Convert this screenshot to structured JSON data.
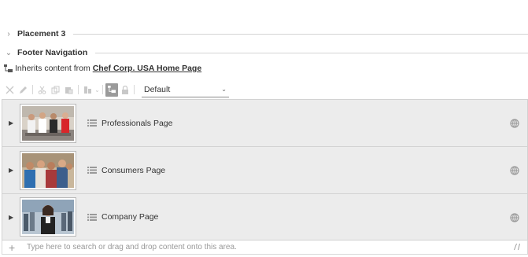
{
  "sections": {
    "placement3": {
      "title": "Placement 3",
      "expanded": false
    },
    "footer_navigation": {
      "title": "Footer Navigation",
      "expanded": true
    }
  },
  "inherit": {
    "prefix": "Inherits content from",
    "link": "Chef Corp. USA Home Page"
  },
  "toolbar": {
    "icons": [
      "close-icon",
      "edit-icon",
      "cut-icon",
      "copy-icon",
      "paste-icon",
      "paste-special-icon",
      "inherit-icon",
      "lock-icon"
    ],
    "select_value": "Default"
  },
  "items": [
    {
      "label": "Professionals Page",
      "thumb": "chefs-kitchen-image"
    },
    {
      "label": "Consumers Page",
      "thumb": "friends-group-image"
    },
    {
      "label": "Company Page",
      "thumb": "business-woman-crowd-image"
    }
  ],
  "dropzone": {
    "placeholder": "Type here to search or drag and drop content onto this area."
  }
}
